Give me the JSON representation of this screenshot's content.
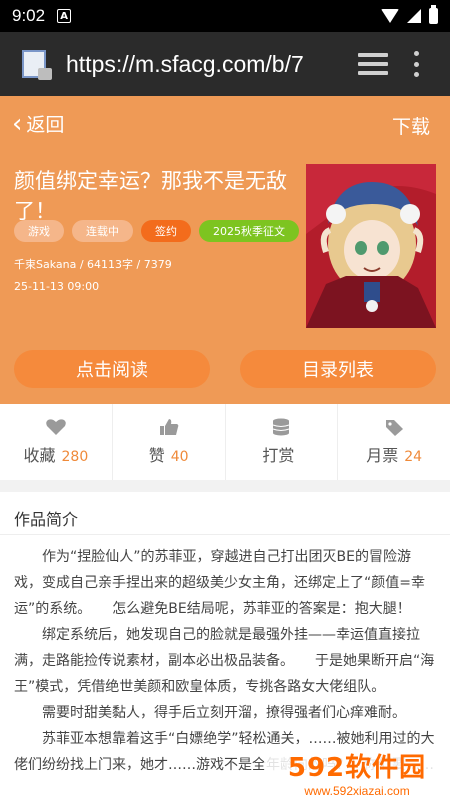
{
  "status_bar": {
    "time": "9:02",
    "notification_icon": "A"
  },
  "browser": {
    "url": "https://m.sfacg.com/b/7"
  },
  "header": {
    "back_label": "返回",
    "download_label": "下载"
  },
  "book": {
    "title": "颜值绑定幸运？那我不是无敌了！",
    "tags": [
      "游戏",
      "连载中",
      "签约",
      "2025秋季征文"
    ],
    "author_info": "千束Sakana / 64113字 / 7379",
    "updated": "25-11-13 09:00"
  },
  "actions": {
    "read_label": "点击阅读",
    "toc_label": "目录列表"
  },
  "stats": [
    {
      "label": "收藏",
      "value": "280",
      "icon": "heart-icon"
    },
    {
      "label": "赞",
      "value": "40",
      "icon": "thumbs-up-icon"
    },
    {
      "label": "打赏",
      "value": "",
      "icon": "coins-icon"
    },
    {
      "label": "月票",
      "value": "24",
      "icon": "ticket-icon"
    }
  ],
  "intro": {
    "heading": "作品简介",
    "paragraphs": [
      "作为“捏脸仙人”的苏菲亚，穿越进自己打出团灭BE的冒险游戏，变成自己亲手捏出来的超级美少女主角，还绑定上了“颜值=幸运”的系统。　　怎么避免BE结局呢，苏菲亚的答案是：抱大腿！",
      "绑定系统后，她发现自己的脸就是最强外挂——幸运值直接拉满，走路能捡传说素材，副本必出极品装备。　　于是她果断开启“海王”模式，凭借绝世美颜和欧皇体质，专挑各路女大佬组队。",
      "需要时甜美黏人，得手后立刻开溜，撩得强者们心痒难耐。",
      "苏菲亚本想靠着这手“白嫖绝学”轻松通关，……被她利用过的大佬们纷纷找上门来，她才……游戏不是全年龄向的吗？！你们要……"
    ]
  },
  "watermark": {
    "big": "592软件园",
    "small": "www.592xiazai.com"
  },
  "colors": {
    "accent": "#ef9a56",
    "button": "#f58a3c",
    "highlight": "#ef8a3a"
  }
}
